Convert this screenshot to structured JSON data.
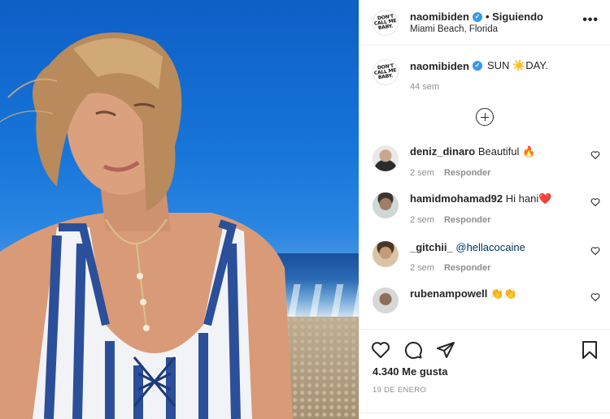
{
  "post": {
    "username": "naomibiden",
    "follow_status": "• Siguiendo",
    "location": "Miami Beach, Florida",
    "logo_lines": [
      "DON'T",
      "CALL ME",
      "BABY."
    ],
    "more_icon": "more-horizontal-icon"
  },
  "caption": {
    "username": "naomibiden",
    "text": "SUN ☀️DAY.",
    "time": "44 sem"
  },
  "comments": [
    {
      "username": "deniz_dinaro",
      "text": "Beautiful 🔥",
      "time": "2 sem",
      "reply_label": "Responder"
    },
    {
      "username": "hamidmohamad92",
      "text": "Hi hani❤️",
      "time": "2 sem",
      "reply_label": "Responder"
    },
    {
      "username": "_gitchii_",
      "text": "@hellacocaine",
      "time": "2 sem",
      "reply_label": "Responder"
    },
    {
      "username": "rubenampowell",
      "text": "👏👏",
      "time": "",
      "reply_label": ""
    }
  ],
  "actions": {
    "likes": "4.340 Me gusta",
    "date": "19 DE ENERO"
  },
  "colors": {
    "verified": "#3897f0",
    "secondary_text": "#8e8e8e",
    "border": "#efefef"
  }
}
